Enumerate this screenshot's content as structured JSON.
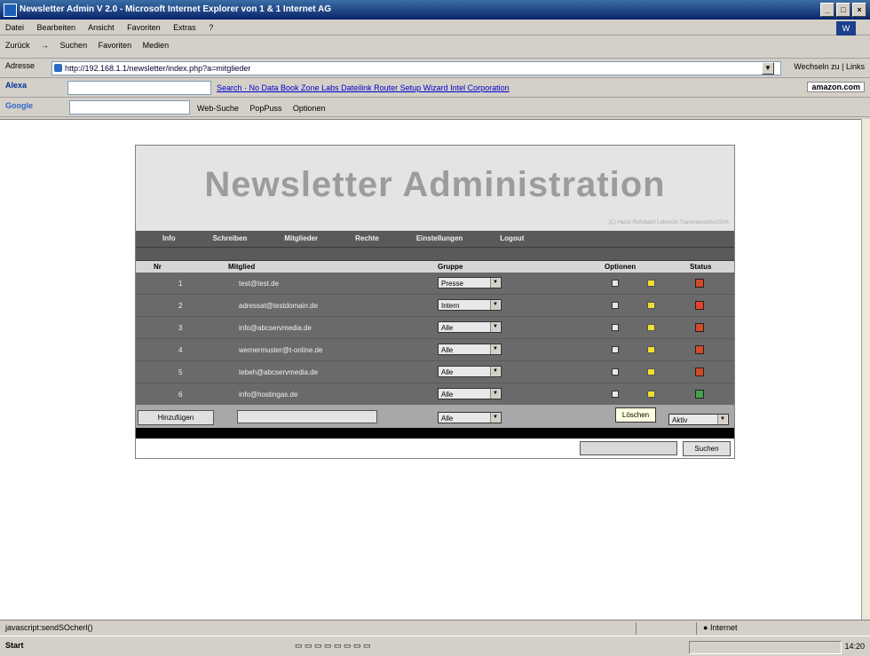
{
  "window": {
    "title": "Newsletter Admin V 2.0 - Microsoft Internet Explorer von 1 & 1 Internet AG"
  },
  "menu": [
    "Datei",
    "Bearbeiten",
    "Ansicht",
    "Favoriten",
    "Extras",
    "?"
  ],
  "toolbar": {
    "back": "Zurück",
    "search": "Suchen",
    "favorites": "Favoriten",
    "media": "Medien"
  },
  "address": {
    "label": "Adresse",
    "url": "http://192.168.1.1/newsletter/index.php?a=mitglieder",
    "go": "Wechseln zu",
    "links": "Links"
  },
  "alexa": {
    "logo": "Alexa",
    "search_btn": "Search",
    "links_text": "No Data  Book  Zone Labs  Dateilink Router Setup Wizard  Intel Corporation",
    "amazon": "amazon.com"
  },
  "google": {
    "logo": "Google",
    "web_search": "Web-Suche",
    "popups": "PopPuss",
    "options": "Optionen"
  },
  "page": {
    "title": "Newsletter Administration",
    "subtitle": "(C) Heinz Rohrbach Lebrecht Transnewsletter2004",
    "nav": [
      "Info",
      "Schreiben",
      "Mitglieder",
      "Rechte",
      "Einstellungen",
      "Logout"
    ],
    "headers": {
      "nr": "Nr",
      "member": "Mitglied",
      "group": "Gruppe",
      "options": "Optionen",
      "status": "Status"
    },
    "rows": [
      {
        "nr": "1",
        "email": "test@test.de",
        "group": "Presse"
      },
      {
        "nr": "2",
        "email": "adressat@testdomain.de",
        "group": "Intern"
      },
      {
        "nr": "3",
        "email": "info@abcservmedia.de",
        "group": "Alle"
      },
      {
        "nr": "4",
        "email": "wernermuster@t-online.de",
        "group": "Alle"
      },
      {
        "nr": "5",
        "email": "tebeh@abcservmedia.de",
        "group": "Alle"
      },
      {
        "nr": "6",
        "email": "info@hostingas.de",
        "group": "Alle"
      }
    ],
    "status_colors": [
      "#d24a26",
      "#e8402c",
      "#d24a26",
      "#d24a26",
      "#d24a26",
      "#3ea448"
    ],
    "add_button": "Hinzufügen",
    "add_group": "Alle",
    "delete_button": "Löschen",
    "action_select": "Aktiv",
    "search_button": "Suchen"
  },
  "status": {
    "text": "javascript:sendSOcherl()",
    "zone": "Internet"
  },
  "taskbar": {
    "start": "Start",
    "clock": "14:20"
  }
}
